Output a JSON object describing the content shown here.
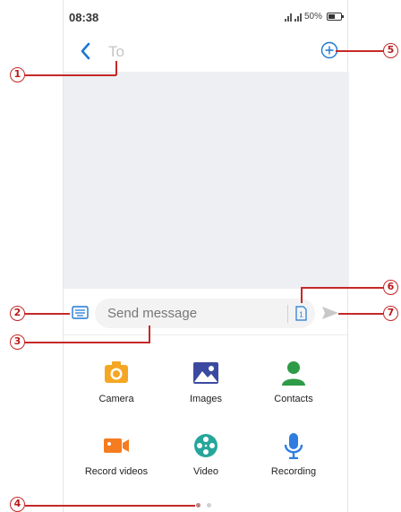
{
  "status_bar": {
    "time": "08:38",
    "battery": "50%",
    "battery_level": 0.5
  },
  "header": {
    "to_placeholder": "To",
    "back_icon": "chevron-left-icon",
    "add_icon": "plus-circle-icon"
  },
  "composer": {
    "placeholder": "Send message",
    "sim_label": "1",
    "keyboard_icon": "keyboard-icon",
    "send_icon": "send-icon"
  },
  "attachments": [
    {
      "label": "Camera",
      "icon": "camera-icon",
      "color": "#f5a623"
    },
    {
      "label": "Images",
      "icon": "images-icon",
      "color": "#3b4aa0"
    },
    {
      "label": "Contacts",
      "icon": "contact-icon",
      "color": "#2e9b47"
    },
    {
      "label": "Record videos",
      "icon": "video-camera-icon",
      "color": "#f57c1f"
    },
    {
      "label": "Video",
      "icon": "film-reel-icon",
      "color": "#26a69a"
    },
    {
      "label": "Recording",
      "icon": "microphone-icon",
      "color": "#2f7de1"
    }
  ],
  "pager": {
    "pages": 2,
    "current": 1
  },
  "callouts": [
    "1",
    "2",
    "3",
    "4",
    "5",
    "6",
    "7"
  ],
  "colors": {
    "accent": "#1e78d2",
    "callout": "#c62828",
    "conversation_bg": "#eeeff2"
  }
}
